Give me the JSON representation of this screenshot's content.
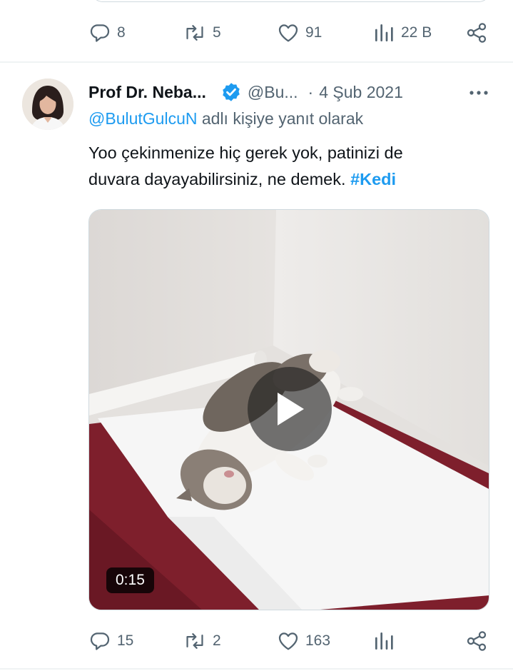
{
  "top_tweet": {
    "actions": {
      "replies": "8",
      "retweets": "5",
      "likes": "91",
      "views": "22 B"
    }
  },
  "tweet": {
    "author_name": "Prof Dr. Neba...",
    "handle": "@Bu...",
    "separator": "·",
    "date": "4 Şub 2021",
    "reply_to_handle": "@BulutGulcuN",
    "reply_to_suffix": " adlı kişiye yanıt olarak",
    "text_line1": "Yoo çekinmenize hiç gerek yok, patinizi de",
    "text_line2": "duvara dayayabilirsiniz, ne demek. ",
    "hashtag": "#Kedi",
    "video_duration": "0:15",
    "actions": {
      "replies": "15",
      "retweets": "2",
      "likes": "163"
    }
  },
  "colors": {
    "accent": "#1d9bf0",
    "muted": "#536471",
    "text": "#0f1419",
    "divider": "#eff3f4"
  },
  "icons": [
    "reply-icon",
    "retweet-icon",
    "like-icon",
    "views-icon",
    "share-icon",
    "verified-badge-icon",
    "more-icon",
    "play-icon"
  ]
}
